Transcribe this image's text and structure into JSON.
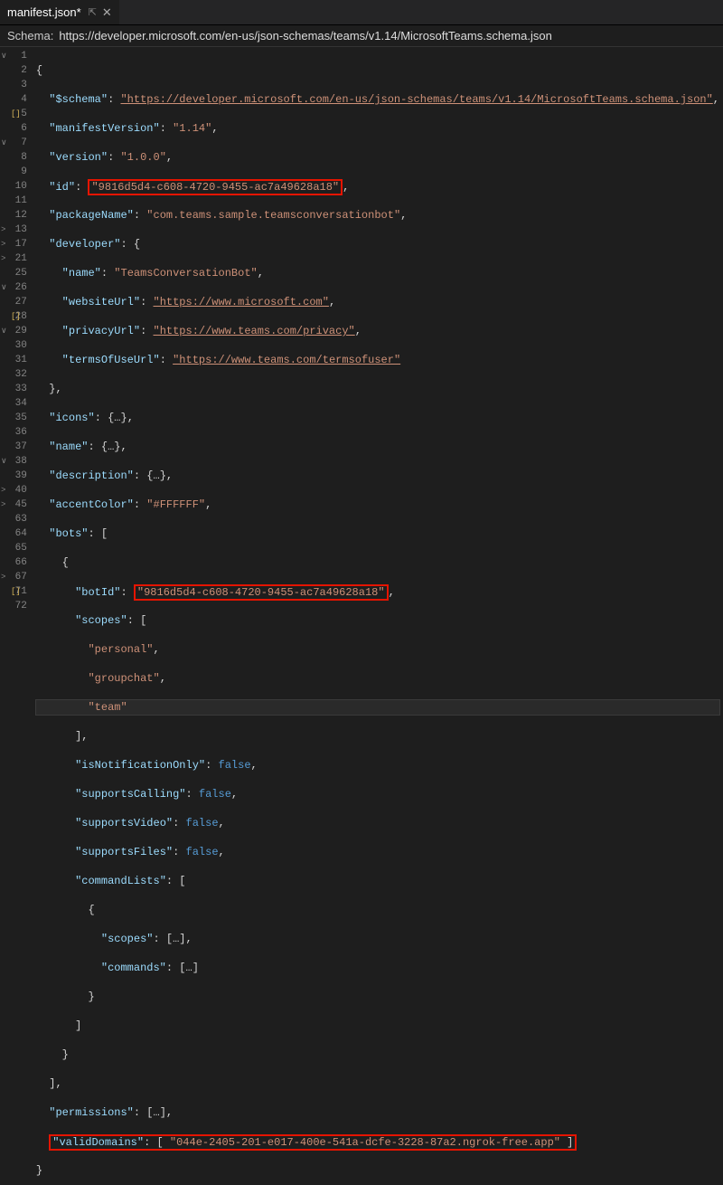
{
  "tab": {
    "title": "manifest.json*",
    "pin_icon": "⊕",
    "close_icon": "✕"
  },
  "schema": {
    "label": "Schema:",
    "url": "https://developer.microsoft.com/en-us/json-schemas/teams/v1.14/MicrosoftTeams.schema.json"
  },
  "gutter": [
    {
      "n": "1",
      "fold": "∨"
    },
    {
      "n": "2"
    },
    {
      "n": "3"
    },
    {
      "n": "4"
    },
    {
      "n": "5",
      "mark": "[]"
    },
    {
      "n": "6"
    },
    {
      "n": "7",
      "fold": "∨"
    },
    {
      "n": "8"
    },
    {
      "n": "9"
    },
    {
      "n": "10"
    },
    {
      "n": "11"
    },
    {
      "n": "12"
    },
    {
      "n": "13",
      "fold": ">"
    },
    {
      "n": "17",
      "fold": ">"
    },
    {
      "n": "21",
      "fold": ">"
    },
    {
      "n": "25"
    },
    {
      "n": "26",
      "fold": "∨"
    },
    {
      "n": "27"
    },
    {
      "n": "28",
      "mark": "[]"
    },
    {
      "n": "29",
      "fold": "∨"
    },
    {
      "n": "30"
    },
    {
      "n": "31"
    },
    {
      "n": "32"
    },
    {
      "n": "33"
    },
    {
      "n": "34"
    },
    {
      "n": "35"
    },
    {
      "n": "36"
    },
    {
      "n": "37"
    },
    {
      "n": "38",
      "fold": "∨"
    },
    {
      "n": "39"
    },
    {
      "n": "40",
      "fold": ">"
    },
    {
      "n": "45",
      "fold": ">"
    },
    {
      "n": "63"
    },
    {
      "n": "64"
    },
    {
      "n": "65"
    },
    {
      "n": "66"
    },
    {
      "n": "67",
      "fold": ">"
    },
    {
      "n": "71",
      "mark": "[]"
    },
    {
      "n": "72"
    }
  ],
  "json": {
    "schema_key": "\"$schema\"",
    "schema_val": "\"https://developer.microsoft.com/en-us/json-schemas/teams/v1.14/MicrosoftTeams.schema.json\"",
    "manifestVersion_key": "\"manifestVersion\"",
    "manifestVersion_val": "\"1.14\"",
    "version_key": "\"version\"",
    "version_val": "\"1.0.0\"",
    "id_key": "\"id\"",
    "id_val": "\"9816d5d4-c608-4720-9455-ac7a49628a18\"",
    "packageName_key": "\"packageName\"",
    "packageName_val": "\"com.teams.sample.teamsconversationbot\"",
    "developer_key": "\"developer\"",
    "dev_name_key": "\"name\"",
    "dev_name_val": "\"TeamsConversationBot\"",
    "websiteUrl_key": "\"websiteUrl\"",
    "websiteUrl_val": "\"https://www.microsoft.com\"",
    "privacyUrl_key": "\"privacyUrl\"",
    "privacyUrl_val": "\"https://www.teams.com/privacy\"",
    "termsOfUseUrl_key": "\"termsOfUseUrl\"",
    "termsOfUseUrl_val": "\"https://www.teams.com/termsofuser\"",
    "icons_key": "\"icons\"",
    "name_key": "\"name\"",
    "description_key": "\"description\"",
    "accentColor_key": "\"accentColor\"",
    "accentColor_val": "\"#FFFFFF\"",
    "bots_key": "\"bots\"",
    "botId_key": "\"botId\"",
    "botId_val": "\"9816d5d4-c608-4720-9455-ac7a49628a18\"",
    "scopes_key": "\"scopes\"",
    "scope1": "\"personal\"",
    "scope2": "\"groupchat\"",
    "scope3": "\"team\"",
    "isNotificationOnly_key": "\"isNotificationOnly\"",
    "supportsCalling_key": "\"supportsCalling\"",
    "supportsVideo_key": "\"supportsVideo\"",
    "supportsFiles_key": "\"supportsFiles\"",
    "false_val": "false",
    "commandLists_key": "\"commandLists\"",
    "commands_key": "\"commands\"",
    "permissions_key": "\"permissions\"",
    "validDomains_key": "\"validDomains\"",
    "validDomains_val": "\"044e-2405-201-e017-400e-541a-dcfe-3228-87a2.ngrok-free.app\"",
    "collapsed": "…"
  }
}
